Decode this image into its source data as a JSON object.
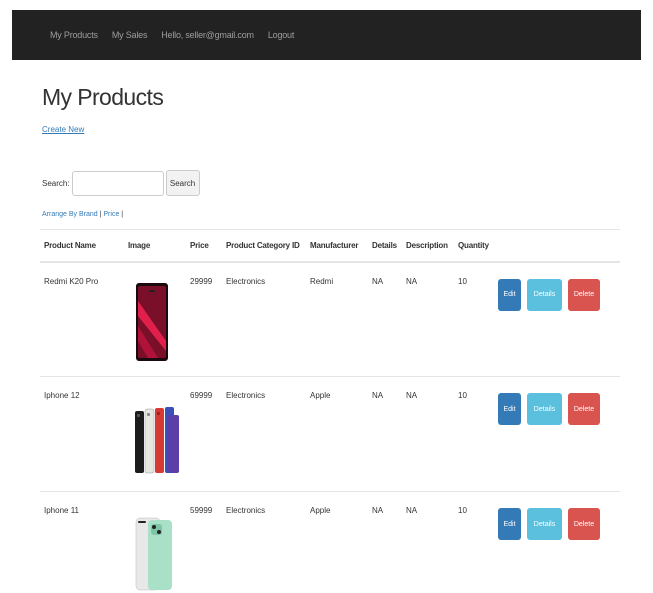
{
  "nav": {
    "items": [
      "My Products",
      "My Sales",
      "Hello, seller@gmail.com",
      "Logout"
    ]
  },
  "page": {
    "title": "My Products",
    "create_link": "Create New"
  },
  "search": {
    "label": "Search:",
    "value": "",
    "button_label": "Search"
  },
  "sort": {
    "prefix": "Arrange By Brand",
    "separator": "|",
    "price": "Price",
    "suffix": "|"
  },
  "table": {
    "headers": [
      "Product Name",
      "Image",
      "Price",
      "Product Category ID",
      "Manufacturer",
      "Details",
      "Description",
      "Quantity"
    ],
    "rows": [
      {
        "name": "Redmi K20 Pro",
        "image_icon": "red-phone-image",
        "price": "29999",
        "category": "Electronics",
        "manufacturer": "Redmi",
        "details": "NA",
        "description": "NA",
        "quantity": "10",
        "edit_label": "Edit",
        "details_label": "Details",
        "delete_label": "Delete"
      },
      {
        "name": "Iphone 12",
        "image_icon": "multi-color-phones-image",
        "price": "69999",
        "category": "Electronics",
        "manufacturer": "Apple",
        "details": "NA",
        "description": "NA",
        "quantity": "10",
        "edit_label": "Edit",
        "details_label": "Details",
        "delete_label": "Delete"
      },
      {
        "name": "Iphone 11",
        "image_icon": "green-phone-image",
        "price": "59999",
        "category": "Electronics",
        "manufacturer": "Apple",
        "details": "NA",
        "description": "NA",
        "quantity": "10",
        "edit_label": "Edit",
        "details_label": "Details",
        "delete_label": "Delete"
      }
    ]
  },
  "colors": {
    "navbar": "#222222",
    "link": "#337ab7",
    "edit": "#337ab7",
    "details": "#5bc0de",
    "delete": "#d9534f"
  }
}
